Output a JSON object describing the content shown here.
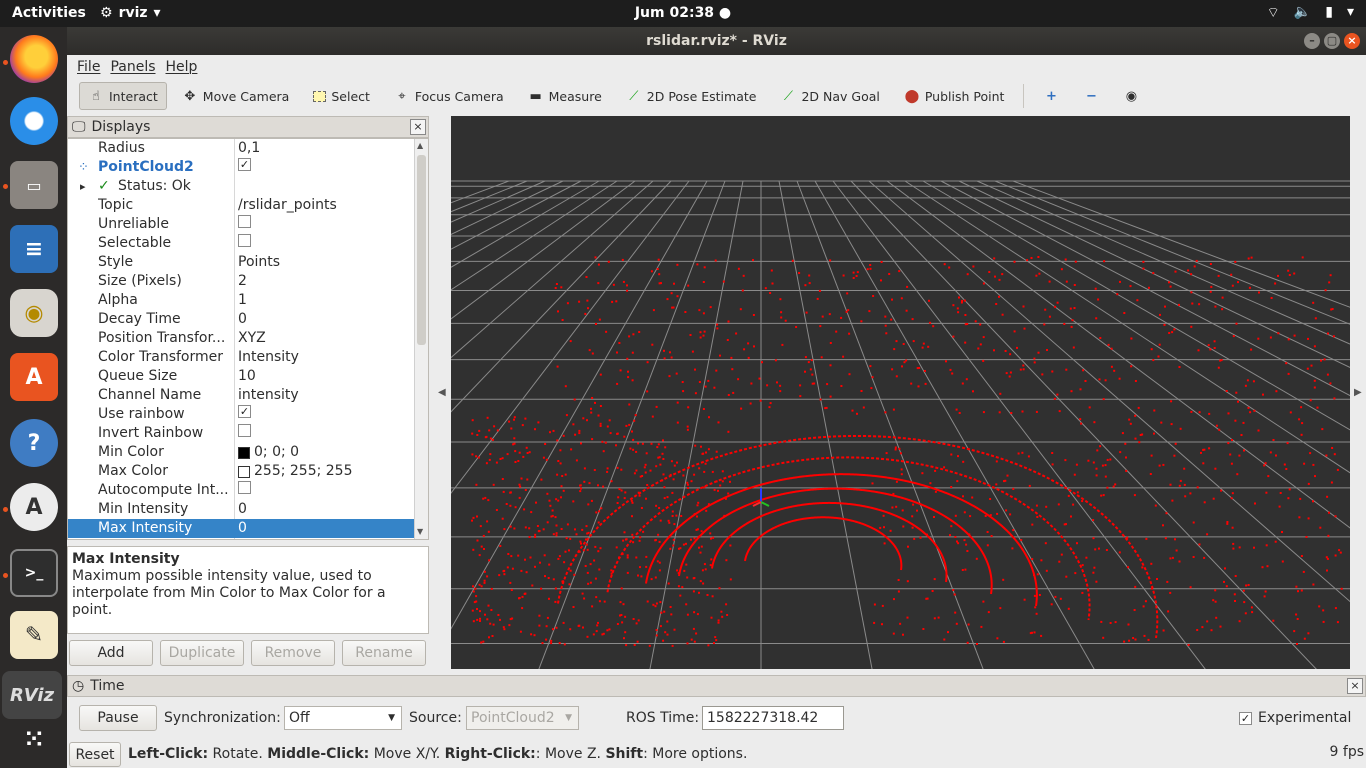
{
  "topbar": {
    "activities": "Activities",
    "app_name": "rviz",
    "clock": "Jum 02:38 ●",
    "icons": [
      "network-icon",
      "volume-icon",
      "battery-icon",
      "menu-arrow-icon"
    ]
  },
  "dock": {
    "items": [
      "firefox-icon",
      "thunderbird-icon",
      "files-icon",
      "writer-icon",
      "rhythmbox-icon",
      "software-icon",
      "help-icon",
      "updater-icon",
      "terminal-icon",
      "text-editor-icon",
      "rviz-icon",
      "app-grid-icon"
    ],
    "rviz_label": "RViz"
  },
  "window": {
    "title": "rslidar.rviz* - RViz"
  },
  "menu": {
    "file": "File",
    "panels": "Panels",
    "help": "Help"
  },
  "toolbar": {
    "interact": "Interact",
    "move_camera": "Move Camera",
    "select": "Select",
    "focus_camera": "Focus Camera",
    "measure": "Measure",
    "pose_estimate": "2D Pose Estimate",
    "nav_goal": "2D Nav Goal",
    "publish_point": "Publish Point"
  },
  "displays": {
    "title": "Displays",
    "rows": [
      {
        "key": "Radius",
        "value": "0,1"
      },
      {
        "key": "PointCloud2",
        "value": ""
      },
      {
        "key": "Status: Ok",
        "value": ""
      },
      {
        "key": "Topic",
        "value": "/rslidar_points"
      },
      {
        "key": "Unreliable",
        "value": ""
      },
      {
        "key": "Selectable",
        "value": ""
      },
      {
        "key": "Style",
        "value": "Points"
      },
      {
        "key": "Size (Pixels)",
        "value": "2"
      },
      {
        "key": "Alpha",
        "value": "1"
      },
      {
        "key": "Decay Time",
        "value": "0"
      },
      {
        "key": "Position Transfor...",
        "value": "XYZ"
      },
      {
        "key": "Color Transformer",
        "value": "Intensity"
      },
      {
        "key": "Queue Size",
        "value": "10"
      },
      {
        "key": "Channel Name",
        "value": "intensity"
      },
      {
        "key": "Use rainbow",
        "value": ""
      },
      {
        "key": "Invert Rainbow",
        "value": ""
      },
      {
        "key": "Min Color",
        "value": "0; 0; 0"
      },
      {
        "key": "Max Color",
        "value": "255; 255; 255"
      },
      {
        "key": "Autocompute Int...",
        "value": ""
      },
      {
        "key": "Min Intensity",
        "value": "0"
      },
      {
        "key": "Max Intensity",
        "value": "0"
      }
    ],
    "checks": {
      "pointcloud2": true,
      "unreliable": false,
      "selectable": false,
      "use_rainbow": true,
      "invert_rainbow": false,
      "autocompute": false
    },
    "colors": {
      "min_color": "#000000",
      "max_color": "#ffffff",
      "selection": "#3584c8",
      "points": "#ff0000"
    },
    "description_title": "Max Intensity",
    "description_text": "Maximum possible intensity value, used to interpolate from Min Color to Max Color for a point.",
    "buttons": {
      "add": "Add",
      "duplicate": "Duplicate",
      "remove": "Remove",
      "rename": "Rename"
    }
  },
  "time": {
    "title": "Time",
    "pause": "Pause",
    "sync_label": "Synchronization:",
    "sync_value": "Off",
    "source_label": "Source:",
    "source_value": "PointCloud2",
    "ros_time_label": "ROS Time:",
    "ros_time_value": "1582227318.42",
    "experimental": "Experimental",
    "experimental_checked": true
  },
  "status": {
    "reset": "Reset",
    "hint_left_click": "Left-Click:",
    "hint_left_action": " Rotate. ",
    "hint_middle_click": "Middle-Click:",
    "hint_middle_action": " Move X/Y. ",
    "hint_right_click": "Right-Click:",
    "hint_right_action": ": Move Z. ",
    "hint_shift": "Shift",
    "hint_shift_action": ": More options.",
    "fps": "9 fps"
  }
}
